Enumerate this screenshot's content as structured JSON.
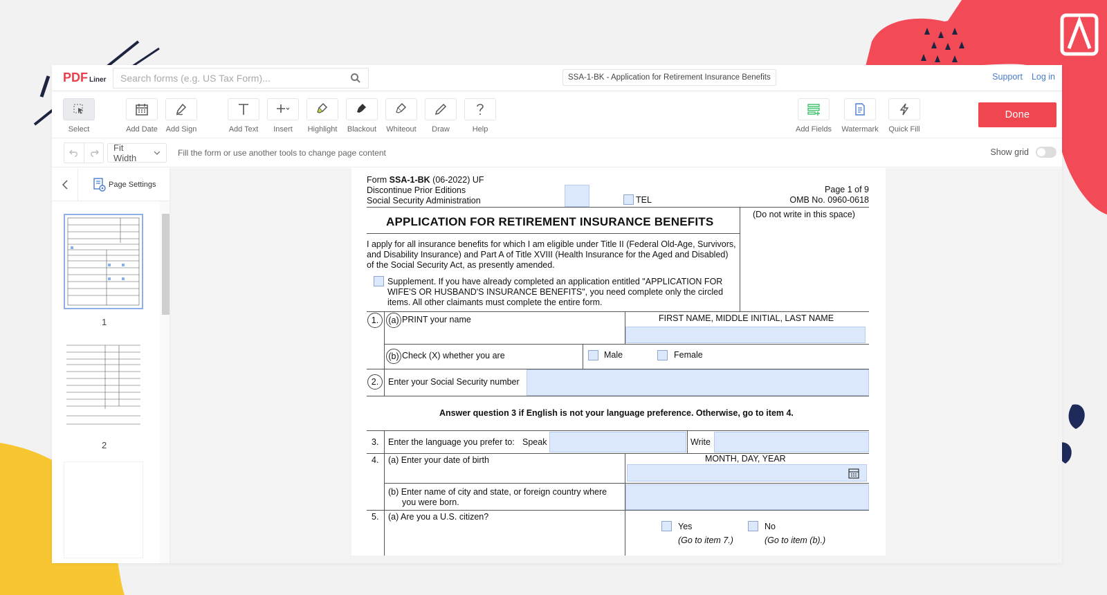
{
  "app": {
    "logo_pdf": "PDF",
    "logo_liner": "Liner",
    "search_placeholder": "Search forms (e.g. US Tax Form)...",
    "document_title": "SSA-1-BK - Application for Retirement Insurance Benefits",
    "links": {
      "support": "Support",
      "login": "Log in"
    }
  },
  "toolbar": {
    "tools": [
      {
        "label": "Select",
        "icon": "select-cursor-icon"
      },
      {
        "label": "Add Date",
        "icon": "calendar-icon"
      },
      {
        "label": "Add Sign",
        "icon": "signature-icon"
      },
      {
        "label": "Add Text",
        "icon": "text-icon"
      },
      {
        "label": "Insert",
        "icon": "plus-icon"
      },
      {
        "label": "Highlight",
        "icon": "highlighter-icon"
      },
      {
        "label": "Blackout",
        "icon": "blackout-icon"
      },
      {
        "label": "Whiteout",
        "icon": "eraser-icon"
      },
      {
        "label": "Draw",
        "icon": "pencil-icon"
      },
      {
        "label": "Help",
        "icon": "help-icon"
      },
      {
        "label": "Add Fields",
        "icon": "add-fields-icon"
      },
      {
        "label": "Watermark",
        "icon": "watermark-icon"
      },
      {
        "label": "Quick Fill",
        "icon": "lightning-icon"
      }
    ],
    "done_label": "Done"
  },
  "subbar": {
    "fit": "Fit Width",
    "hint": "Fill the form or use another tools to change page content",
    "show_grid": "Show grid"
  },
  "side": {
    "page_settings": "Page Settings",
    "pages": [
      "1",
      "2"
    ]
  },
  "form": {
    "form_id_prefix": "Form ",
    "form_id_bold": "SSA-1-BK",
    "form_id_suffix": " (06-2022) UF",
    "discontinue": "Discontinue Prior Editions",
    "agency": "Social Security Administration",
    "tel": "TEL",
    "page_of": "Page 1 of 9",
    "omb": "OMB No. 0960-0618",
    "title": "APPLICATION FOR RETIREMENT INSURANCE BENEFITS",
    "do_not_write": "(Do not write in this space)",
    "intro_1": "I apply for all insurance benefits for which I am eligible under Title II (Federal Old-Age, Survivors,",
    "intro_2": "and Disability Insurance) and Part A of Title XVIII (Health Insurance for the Aged and Disabled)",
    "intro_3": "of the Social Security Act, as presently amended.",
    "supp_1": "Supplement. If you have already completed an application entitled \"APPLICATION FOR",
    "supp_2": "WIFE'S OR HUSBAND'S INSURANCE BENEFITS\", you need complete only the circled",
    "supp_3": "items. All other claimants must complete the entire form.",
    "q1_num": "1.",
    "q1a_letter": "(a)",
    "q1a": "PRINT your name",
    "q1a_hint": "FIRST NAME, MIDDLE INITIAL, LAST NAME",
    "q1b_letter": "(b)",
    "q1b": "Check (X) whether you are",
    "male": "Male",
    "female": "Female",
    "q2_num": "2.",
    "q2": "Enter your Social Security number",
    "answer_note": "Answer question 3 if English is not your language preference. Otherwise, go to item 4.",
    "q3_num": "3.",
    "q3": "Enter the language you prefer to:",
    "speak": "Speak",
    "write": "Write",
    "q4_num": "4.",
    "q4a": "(a) Enter your date of birth",
    "q4a_hint": "MONTH, DAY, YEAR",
    "q4b_1": "(b) Enter name of city and state, or foreign  country where",
    "q4b_2": "you were born.",
    "q5_num": "5.",
    "q5a": "(a) Are you a U.S. citizen?",
    "yes": "Yes",
    "no": "No",
    "yes_note": "(Go to item 7.)",
    "no_note": "(Go to item (b).)"
  },
  "colors": {
    "accent": "#ef4650",
    "field": "#dce8fb",
    "link": "#4a7bd0"
  }
}
